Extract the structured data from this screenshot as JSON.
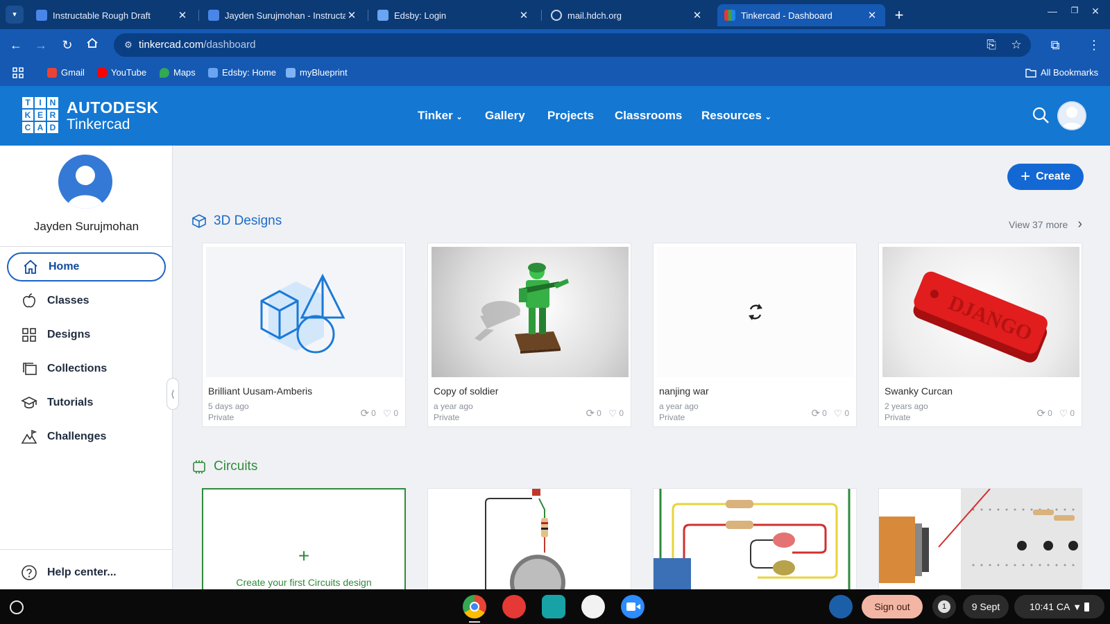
{
  "browser": {
    "tabs": [
      {
        "title": "Instructable Rough Draft",
        "active": false
      },
      {
        "title": "Jayden Surujmohan - Instructab",
        "active": false
      },
      {
        "title": "Edsby: Login",
        "active": false
      },
      {
        "title": "mail.hdch.org",
        "active": false
      },
      {
        "title": "Tinkercad - Dashboard",
        "active": true
      }
    ],
    "url_domain": "tinkercad.com",
    "url_path": "/dashboard",
    "bookmarks": [
      "Gmail",
      "YouTube",
      "Maps",
      "Edsby: Home",
      "myBlueprint"
    ],
    "all_bookmarks": "All Bookmarks"
  },
  "header": {
    "logo_letters": [
      "T",
      "I",
      "N",
      "K",
      "E",
      "R",
      "C",
      "A",
      "D"
    ],
    "brand_line1": "AUTODESK",
    "brand_line2": "Tinkercad",
    "nav": [
      "Tinker",
      "Gallery",
      "Projects",
      "Classrooms",
      "Resources"
    ]
  },
  "sidebar": {
    "username": "Jayden Surujmohan",
    "items": [
      "Home",
      "Classes",
      "Designs",
      "Collections",
      "Tutorials",
      "Challenges"
    ],
    "help": "Help center..."
  },
  "main": {
    "create_label": "Create",
    "designs_title": "3D Designs",
    "view_more": "View 37 more",
    "designs": [
      {
        "name": "Brilliant Uusam-Amberis",
        "date": "5 days ago",
        "privacy": "Private",
        "remixes": "0",
        "likes": "0"
      },
      {
        "name": "Copy of soldier",
        "date": "a year ago",
        "privacy": "Private",
        "remixes": "0",
        "likes": "0"
      },
      {
        "name": "nanjing war",
        "date": "a year ago",
        "privacy": "Private",
        "remixes": "0",
        "likes": "0"
      },
      {
        "name": "Swanky Curcan",
        "date": "2 years ago",
        "privacy": "Private",
        "remixes": "0",
        "likes": "0"
      }
    ],
    "keychain_text": "DJANGO",
    "circuits_title": "Circuits",
    "create_circuit": "Create your first Circuits design"
  },
  "taskbar": {
    "sign_out": "Sign out",
    "notifications": "1",
    "date": "9 Sept",
    "time": "10:41",
    "region": "CA"
  },
  "colors": {
    "tinkercad_blue": "#1477d2",
    "chrome_dark": "#0b3a75",
    "circuits_green": "#2e8b3a"
  }
}
